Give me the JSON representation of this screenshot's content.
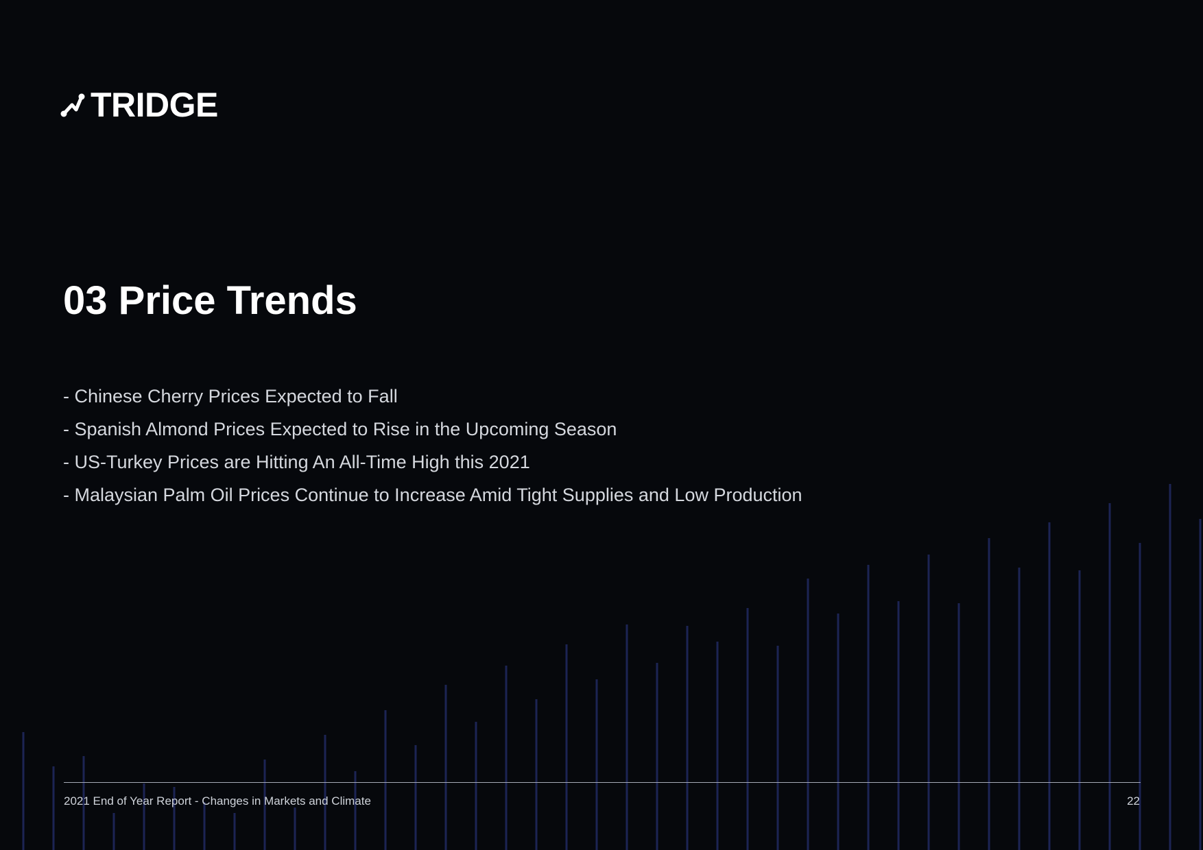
{
  "brand": {
    "name": "TRIDGE",
    "logo_icon": "tridge-node-icon"
  },
  "section": {
    "title": "03 Price Trends"
  },
  "bullets": [
    "- Chinese Cherry Prices Expected to Fall",
    "- Spanish Almond Prices Expected to Rise in the Upcoming Season",
    "- US-Turkey Prices are Hitting An All-Time High this 2021",
    "- Malaysian Palm Oil Prices Continue to Increase Amid Tight Supplies and Low Production"
  ],
  "footer": {
    "report_title": "2021 End of Year Report - Changes in Markets and Climate",
    "page_number": "22"
  },
  "colors": {
    "background": "#06080c",
    "text": "#ffffff",
    "body_text": "#d5d8de",
    "decor_lines": "#1c2454"
  }
}
